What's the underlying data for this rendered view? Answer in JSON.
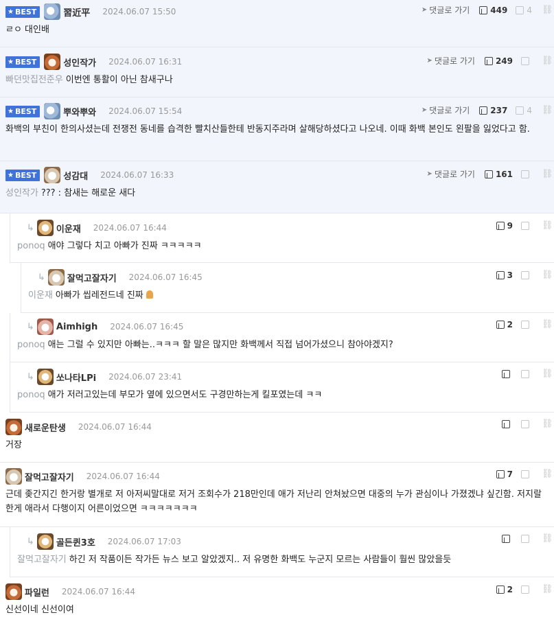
{
  "best_label": "BEST",
  "goto_label": "댓글로 가기",
  "comments": [
    {
      "nick": "習近平",
      "date": "2024.06.07 15:50",
      "mention": "",
      "text": "ㄹㅇ 대인배",
      "likes": "449",
      "dislikes": "4"
    },
    {
      "nick": "성인작가",
      "date": "2024.06.07 16:31",
      "mention": "빠던맛집전준우",
      "text": "이번엔 통활이 아닌 참새구나",
      "likes": "249",
      "dislikes": ""
    },
    {
      "nick": "뿌와뿌와",
      "date": "2024.06.07 15:54",
      "mention": "",
      "text": "화백의 부친이 한의사셨는데 전쟁전 동네를 습격한 빨치산들한테 반동지주라며 살해당하셨다고 나오네. 이때 화백 본인도 왼팔을 잃었다고 함.",
      "likes": "237",
      "dislikes": "4"
    },
    {
      "nick": "성감대",
      "date": "2024.06.07 16:33",
      "mention": "성인작가",
      "text": "??? : 참새는 해로운 새다",
      "likes": "161",
      "dislikes": ""
    },
    {
      "nick": "이운재",
      "date": "2024.06.07 16:44",
      "mention": "ponoq",
      "text": "애야 그렇다 치고 아빠가 진짜 ㅋㅋㅋㅋㅋ",
      "likes": "9",
      "dislikes": ""
    },
    {
      "nick": "잘먹고잘자기",
      "date": "2024.06.07 16:45",
      "mention": "이운재",
      "text": "아빠가 씹레전드네 진짜",
      "likes": "3",
      "dislikes": ""
    },
    {
      "nick": "Aimhigh",
      "date": "2024.06.07 16:45",
      "mention": "ponoq",
      "text": "애는 그럴 수 있지만 아빠는..ㅋㅋㅋ 할 말은 많지만 화백께서 직접 넘어가셨으니 참아야겠지?",
      "likes": "2",
      "dislikes": ""
    },
    {
      "nick": "쏘나타LPi",
      "date": "2024.06.07 23:41",
      "mention": "ponoq",
      "text": "애가 저러고있는데 부모가 옆에 있으면서도 구경만하는게 킬포였는데 ㅋㅋ",
      "likes": "",
      "dislikes": ""
    },
    {
      "nick": "새로운탄생",
      "date": "2024.06.07 16:44",
      "mention": "",
      "text": "거장",
      "likes": "",
      "dislikes": ""
    },
    {
      "nick": "잘먹고잘자기",
      "date": "2024.06.07 16:44",
      "mention": "",
      "text": "근데 좆간지긴 한거랑 별개로 저 아저씨말대로 저거 조회수가 218만인데 애가 저난리 안쳐놨으면 대중의 누가 관심이나 가졌겠냐 싶긴함. 저지랄 한게 애라서 다행이지 어른이었으면 ㅋㅋㅋㅋㅋㅋㅋ",
      "likes": "7",
      "dislikes": ""
    },
    {
      "nick": "골든퀸3호",
      "date": "2024.06.07 17:03",
      "mention": "잘먹고잘자기",
      "text": "하긴 저 작품이든 작가든 뉴스 보고 알았겠지.. 저 유명한 화백도 누군지 모르는 사람들이 훨씬 많았을듯",
      "likes": "",
      "dislikes": ""
    },
    {
      "nick": "파일런",
      "date": "2024.06.07 16:44",
      "mention": "",
      "text": "신선이네 신선이여",
      "likes": "2",
      "dislikes": ""
    }
  ]
}
